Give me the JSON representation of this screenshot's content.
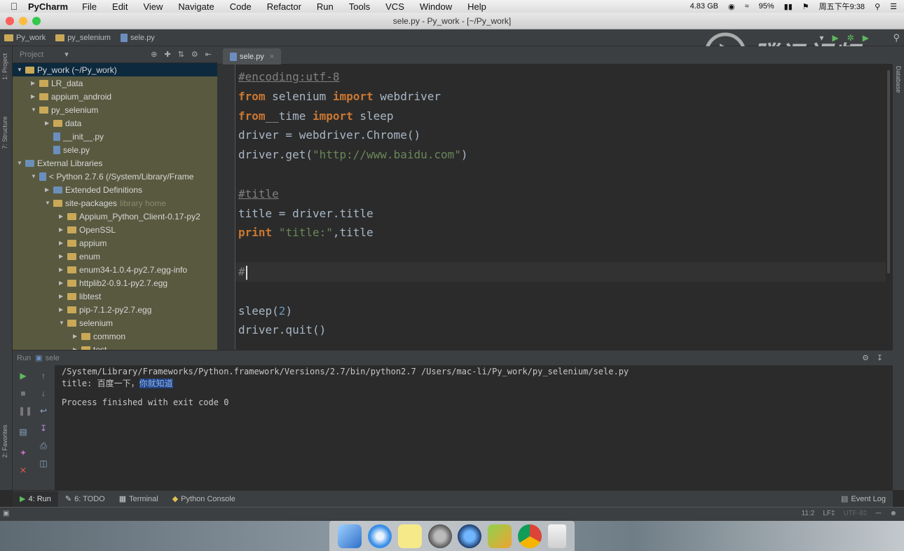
{
  "menubar": {
    "app_name": "PyCharm",
    "items": [
      "File",
      "Edit",
      "View",
      "Navigate",
      "Code",
      "Refactor",
      "Run",
      "Tools",
      "VCS",
      "Window",
      "Help"
    ],
    "memory": "4.83 GB",
    "battery": "95%",
    "clock": "周五下午9:38"
  },
  "window": {
    "title": "sele.py - Py_work - [~/Py_work]"
  },
  "navbar": {
    "crumbs": [
      "Py_work",
      "py_selenium",
      "sele.py"
    ]
  },
  "watermark": {
    "text": "腾讯视频"
  },
  "left_strip": {
    "project_label": "1: Project",
    "structure_label": "7: Structure",
    "favorites_label": "2: Favorites"
  },
  "right_strip": {
    "database_label": "Database"
  },
  "project": {
    "header": "Project",
    "tree": [
      {
        "label": "Py_work (~/Py_work)",
        "depth": 0,
        "arrow": "▼",
        "kind": "folder",
        "selected": true
      },
      {
        "label": "LR_data",
        "depth": 1,
        "arrow": "▶",
        "kind": "folder"
      },
      {
        "label": "appium_android",
        "depth": 1,
        "arrow": "▶",
        "kind": "folder"
      },
      {
        "label": "py_selenium",
        "depth": 1,
        "arrow": "▼",
        "kind": "folder"
      },
      {
        "label": "data",
        "depth": 2,
        "arrow": "▶",
        "kind": "folder"
      },
      {
        "label": "__init__.py",
        "depth": 2,
        "arrow": "",
        "kind": "py"
      },
      {
        "label": "sele.py",
        "depth": 2,
        "arrow": "",
        "kind": "py"
      },
      {
        "label": "External Libraries",
        "depth": 0,
        "arrow": "▼",
        "kind": "lib"
      },
      {
        "label": "< Python 2.7.6 (/System/Library/Frame",
        "depth": 1,
        "arrow": "▼",
        "kind": "py"
      },
      {
        "label": "Extended Definitions",
        "depth": 2,
        "arrow": "▶",
        "kind": "lib"
      },
      {
        "label": "site-packages",
        "hint": "library home",
        "depth": 2,
        "arrow": "▼",
        "kind": "folder"
      },
      {
        "label": "Appium_Python_Client-0.17-py2",
        "depth": 3,
        "arrow": "▶",
        "kind": "folder"
      },
      {
        "label": "OpenSSL",
        "depth": 3,
        "arrow": "▶",
        "kind": "folder"
      },
      {
        "label": "appium",
        "depth": 3,
        "arrow": "▶",
        "kind": "folder"
      },
      {
        "label": "enum",
        "depth": 3,
        "arrow": "▶",
        "kind": "folder"
      },
      {
        "label": "enum34-1.0.4-py2.7.egg-info",
        "depth": 3,
        "arrow": "▶",
        "kind": "folder"
      },
      {
        "label": "httplib2-0.9.1-py2.7.egg",
        "depth": 3,
        "arrow": "▶",
        "kind": "folder"
      },
      {
        "label": "libtest",
        "depth": 3,
        "arrow": "▶",
        "kind": "folder"
      },
      {
        "label": "pip-7.1.2-py2.7.egg",
        "depth": 3,
        "arrow": "▶",
        "kind": "folder"
      },
      {
        "label": "selenium",
        "depth": 3,
        "arrow": "▼",
        "kind": "folder"
      },
      {
        "label": "common",
        "depth": 4,
        "arrow": "▶",
        "kind": "folder"
      },
      {
        "label": "test",
        "depth": 4,
        "arrow": "▶",
        "kind": "folder"
      }
    ]
  },
  "editor": {
    "tab": "sele.py",
    "lines": [
      {
        "tokens": [
          {
            "t": "#encoding:utf-8",
            "c": "cmt"
          }
        ]
      },
      {
        "tokens": [
          {
            "t": "from",
            "c": "kw"
          },
          {
            "t": " selenium ",
            "c": ""
          },
          {
            "t": "import",
            "c": "kw"
          },
          {
            "t": " webdriver",
            "c": ""
          }
        ]
      },
      {
        "tokens": [
          {
            "t": "from",
            "c": "kw"
          },
          {
            "t": "__time ",
            "c": ""
          },
          {
            "t": "import",
            "c": "kw"
          },
          {
            "t": " sleep",
            "c": ""
          }
        ]
      },
      {
        "tokens": [
          {
            "t": "driver = webdriver.Chrome()",
            "c": ""
          }
        ]
      },
      {
        "tokens": [
          {
            "t": "driver.get(",
            "c": ""
          },
          {
            "t": "\"http://www.baidu.com\"",
            "c": "str"
          },
          {
            "t": ")",
            "c": ""
          }
        ]
      },
      {
        "tokens": []
      },
      {
        "tokens": [
          {
            "t": "#title",
            "c": "cmt"
          }
        ]
      },
      {
        "tokens": [
          {
            "t": "title = driver.title",
            "c": ""
          }
        ]
      },
      {
        "tokens": [
          {
            "t": "print",
            "c": "kw"
          },
          {
            "t": " ",
            "c": ""
          },
          {
            "t": "\"title:\"",
            "c": "str"
          },
          {
            "t": ",title",
            "c": ""
          }
        ]
      },
      {
        "tokens": []
      },
      {
        "tokens": [
          {
            "t": "#",
            "c": "cmtplain"
          }
        ]
      },
      {
        "tokens": []
      },
      {
        "tokens": [
          {
            "t": "sleep(",
            "c": ""
          },
          {
            "t": "2",
            "c": "num"
          },
          {
            "t": ")",
            "c": ""
          }
        ]
      },
      {
        "tokens": [
          {
            "t": "driver.quit()",
            "c": ""
          }
        ]
      }
    ]
  },
  "run": {
    "label": "Run",
    "config": "sele",
    "console": {
      "command": "/System/Library/Frameworks/Python.framework/Versions/2.7/bin/python2.7 /Users/mac-li/Py_work/py_selenium/sele.py",
      "title_prefix": "title: 百度一下，",
      "title_highlight": "你就知道",
      "finished": "Process finished with exit code 0"
    }
  },
  "bottom_tabs": [
    {
      "label": "4: Run",
      "active": true
    },
    {
      "label": "6: TODO",
      "active": false
    },
    {
      "label": "Terminal",
      "active": false
    },
    {
      "label": "Python Console",
      "active": false
    }
  ],
  "event_log": "Event Log",
  "status": {
    "position": "11:2",
    "line_sep": "LF‡",
    "encoding": "UTF-8‡"
  },
  "colors": {
    "editor_bg": "#2b2b2b",
    "keyword": "#cc7832",
    "string": "#6a8759",
    "selection": "#0d293e"
  }
}
